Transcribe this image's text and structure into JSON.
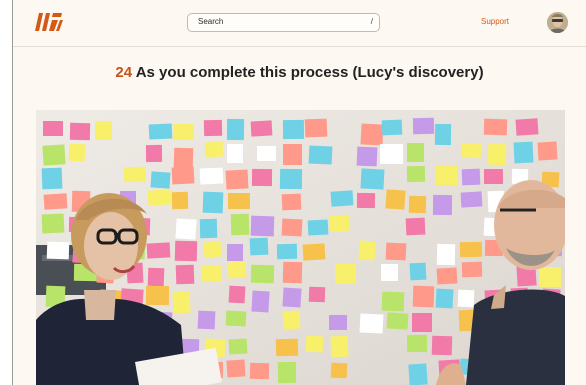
{
  "header": {
    "search_placeholder": "Search",
    "search_shortcut": "/",
    "support_label": "Support"
  },
  "page": {
    "title_number": "24",
    "title_text": "As you complete this process (Lucy's discovery)"
  },
  "colors": {
    "accent": "#d35a16",
    "title_number": "#c8521a",
    "background": "#fdf8f2"
  },
  "icons": {
    "logo": "brand-logo",
    "avatar": "user-avatar"
  }
}
